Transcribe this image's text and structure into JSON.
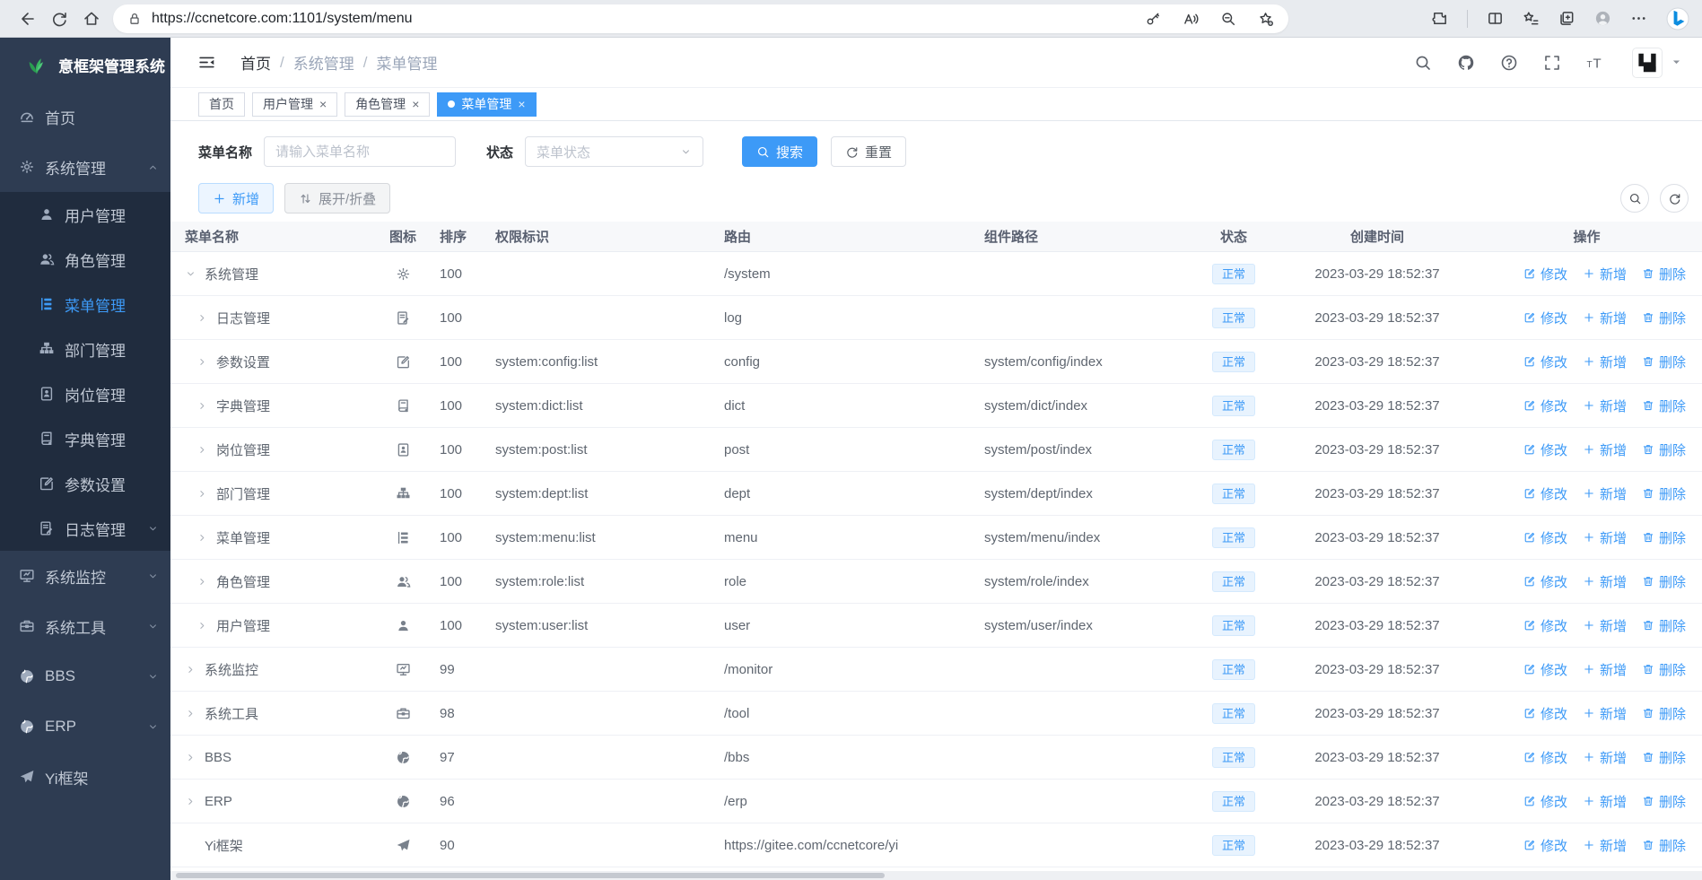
{
  "colors": {
    "accent": "#3d9af7",
    "sidebar_bg": "#2e3c52",
    "sidebar_submenu_bg": "#202c3e",
    "sidebar_text": "#c0c8d4",
    "status_badge_bg": "#e8f3fe"
  },
  "browser": {
    "url": "https://ccnetcore.com:1101/system/menu"
  },
  "sidebar": {
    "logo_text": "意框架管理系统",
    "items": [
      {
        "key": "home",
        "label": "首页",
        "icon": "dashboard",
        "level": 0
      },
      {
        "key": "system-mgmt",
        "label": "系统管理",
        "icon": "gear",
        "level": 0,
        "chevron": "up"
      },
      {
        "key": "user-mgmt",
        "label": "用户管理",
        "icon": "user",
        "level": 1
      },
      {
        "key": "role-mgmt",
        "label": "角色管理",
        "icon": "users",
        "level": 1
      },
      {
        "key": "menu-mgmt",
        "label": "菜单管理",
        "icon": "menu-tree",
        "level": 1,
        "active": true
      },
      {
        "key": "dept-mgmt",
        "label": "部门管理",
        "icon": "org-tree",
        "level": 1
      },
      {
        "key": "post-mgmt",
        "label": "岗位管理",
        "icon": "post-badge",
        "level": 1
      },
      {
        "key": "dict-mgmt",
        "label": "字典管理",
        "icon": "dict-book",
        "level": 1
      },
      {
        "key": "config-settings",
        "label": "参数设置",
        "icon": "config-edit",
        "level": 1
      },
      {
        "key": "log-mgmt",
        "label": "日志管理",
        "icon": "log-edit",
        "level": 1,
        "chevron": "down"
      },
      {
        "key": "system-monitor",
        "label": "系统监控",
        "icon": "monitor",
        "level": 0,
        "chevron": "down"
      },
      {
        "key": "system-tools",
        "label": "系统工具",
        "icon": "toolbox",
        "level": 0,
        "chevron": "down"
      },
      {
        "key": "bbs",
        "label": "BBS",
        "icon": "globe",
        "level": 0,
        "chevron": "down"
      },
      {
        "key": "erp",
        "label": "ERP",
        "icon": "globe",
        "level": 0,
        "chevron": "down"
      },
      {
        "key": "yi-framework",
        "label": "Yi框架",
        "icon": "paper-plane",
        "level": 0
      }
    ]
  },
  "header": {
    "breadcrumb": [
      "首页",
      "系统管理",
      "菜单管理"
    ],
    "separator": "/"
  },
  "tabs": [
    {
      "key": "home",
      "label": "首页",
      "closable": false,
      "active": false
    },
    {
      "key": "user-mgmt",
      "label": "用户管理",
      "closable": true,
      "active": false
    },
    {
      "key": "role-mgmt",
      "label": "角色管理",
      "closable": true,
      "active": false
    },
    {
      "key": "menu-mgmt",
      "label": "菜单管理",
      "closable": true,
      "active": true
    }
  ],
  "filters": {
    "name_label": "菜单名称",
    "name_placeholder": "请输入菜单名称",
    "status_label": "状态",
    "status_placeholder": "菜单状态",
    "search_button": "搜索",
    "reset_button": "重置"
  },
  "toolbar": {
    "add_button": "新增",
    "expand_collapse_button": "展开/折叠"
  },
  "table": {
    "columns": [
      "菜单名称",
      "图标",
      "排序",
      "权限标识",
      "路由",
      "组件路径",
      "状态",
      "创建时间",
      "操作"
    ],
    "actions": {
      "edit": "修改",
      "add": "新增",
      "delete": "删除"
    },
    "rows": [
      {
        "key": "system-mgmt",
        "name": "系统管理",
        "icon": "gear",
        "level": 0,
        "arrow": "down",
        "order": "100",
        "perms": "",
        "route": "/system",
        "component": "",
        "status": "正常",
        "created": "2023-03-29 18:52:37"
      },
      {
        "key": "log-mgmt",
        "name": "日志管理",
        "icon": "log-edit",
        "level": 1,
        "arrow": "right",
        "order": "100",
        "perms": "",
        "route": "log",
        "component": "",
        "status": "正常",
        "created": "2023-03-29 18:52:37"
      },
      {
        "key": "config-settings",
        "name": "参数设置",
        "icon": "config-edit",
        "level": 1,
        "arrow": "right",
        "order": "100",
        "perms": "system:config:list",
        "route": "config",
        "component": "system/config/index",
        "status": "正常",
        "created": "2023-03-29 18:52:37"
      },
      {
        "key": "dict-mgmt",
        "name": "字典管理",
        "icon": "dict-book",
        "level": 1,
        "arrow": "right",
        "order": "100",
        "perms": "system:dict:list",
        "route": "dict",
        "component": "system/dict/index",
        "status": "正常",
        "created": "2023-03-29 18:52:37"
      },
      {
        "key": "post-mgmt",
        "name": "岗位管理",
        "icon": "post-badge",
        "level": 1,
        "arrow": "right",
        "order": "100",
        "perms": "system:post:list",
        "route": "post",
        "component": "system/post/index",
        "status": "正常",
        "created": "2023-03-29 18:52:37"
      },
      {
        "key": "dept-mgmt",
        "name": "部门管理",
        "icon": "org-tree",
        "level": 1,
        "arrow": "right",
        "order": "100",
        "perms": "system:dept:list",
        "route": "dept",
        "component": "system/dept/index",
        "status": "正常",
        "created": "2023-03-29 18:52:37"
      },
      {
        "key": "menu-mgmt",
        "name": "菜单管理",
        "icon": "menu-tree",
        "level": 1,
        "arrow": "right",
        "order": "100",
        "perms": "system:menu:list",
        "route": "menu",
        "component": "system/menu/index",
        "status": "正常",
        "created": "2023-03-29 18:52:37"
      },
      {
        "key": "role-mgmt",
        "name": "角色管理",
        "icon": "users",
        "level": 1,
        "arrow": "right",
        "order": "100",
        "perms": "system:role:list",
        "route": "role",
        "component": "system/role/index",
        "status": "正常",
        "created": "2023-03-29 18:52:37"
      },
      {
        "key": "user-mgmt",
        "name": "用户管理",
        "icon": "user",
        "level": 1,
        "arrow": "right",
        "order": "100",
        "perms": "system:user:list",
        "route": "user",
        "component": "system/user/index",
        "status": "正常",
        "created": "2023-03-29 18:52:37"
      },
      {
        "key": "system-monitor",
        "name": "系统监控",
        "icon": "monitor",
        "level": 0,
        "arrow": "right",
        "order": "99",
        "perms": "",
        "route": "/monitor",
        "component": "",
        "status": "正常",
        "created": "2023-03-29 18:52:37"
      },
      {
        "key": "system-tools",
        "name": "系统工具",
        "icon": "toolbox",
        "level": 0,
        "arrow": "right",
        "order": "98",
        "perms": "",
        "route": "/tool",
        "component": "",
        "status": "正常",
        "created": "2023-03-29 18:52:37"
      },
      {
        "key": "bbs",
        "name": "BBS",
        "icon": "globe",
        "level": 0,
        "arrow": "right",
        "order": "97",
        "perms": "",
        "route": "/bbs",
        "component": "",
        "status": "正常",
        "created": "2023-03-29 18:52:37"
      },
      {
        "key": "erp",
        "name": "ERP",
        "icon": "globe",
        "level": 0,
        "arrow": "right",
        "order": "96",
        "perms": "",
        "route": "/erp",
        "component": "",
        "status": "正常",
        "created": "2023-03-29 18:52:37"
      },
      {
        "key": "yi-framework",
        "name": "Yi框架",
        "icon": "paper-plane",
        "level": 0,
        "arrow": "none",
        "order": "90",
        "perms": "",
        "route": "https://gitee.com/ccnetcore/yi",
        "component": "",
        "status": "正常",
        "created": "2023-03-29 18:52:37"
      }
    ]
  }
}
